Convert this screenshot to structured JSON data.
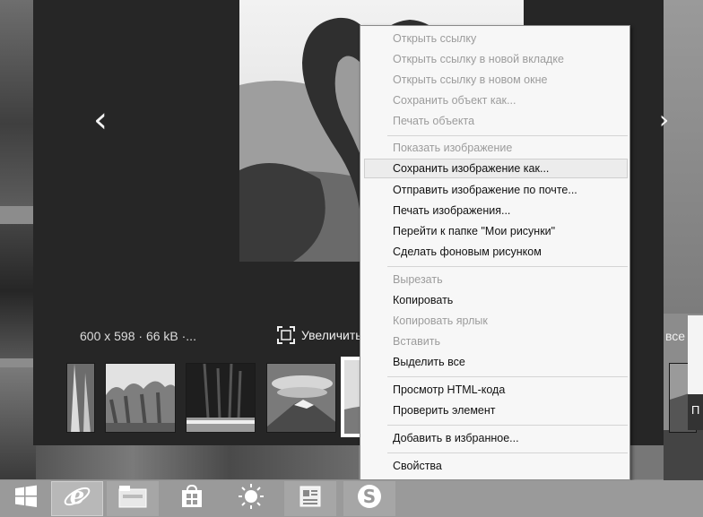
{
  "viewer": {
    "image_info": "600 x 598 · 66 kB ·...",
    "zoom_label": "Увеличить",
    "all_label": "все",
    "prev_glyph": "‹",
    "next_glyph": "›"
  },
  "thumbnails": [
    {
      "name": "thumb-waterfall"
    },
    {
      "name": "thumb-rock-formations"
    },
    {
      "name": "thumb-night-lights"
    },
    {
      "name": "thumb-mountain-clouds"
    },
    {
      "name": "thumb-heart-tree",
      "selected": true
    },
    {
      "name": "thumb-coast"
    }
  ],
  "context_menu": {
    "items": [
      {
        "label": "Открыть ссылку",
        "enabled": false
      },
      {
        "label": "Открыть ссылку в новой вкладке",
        "enabled": false
      },
      {
        "label": "Открыть ссылку в новом окне",
        "enabled": false
      },
      {
        "label": "Сохранить объект как...",
        "enabled": false
      },
      {
        "label": "Печать объекта",
        "enabled": false
      },
      {
        "label": "Показать изображение",
        "enabled": false
      },
      {
        "label": "Сохранить изображение как...",
        "enabled": true,
        "highlighted": true
      },
      {
        "label": "Отправить изображение по почте...",
        "enabled": true
      },
      {
        "label": "Печать изображения...",
        "enabled": true
      },
      {
        "label": "Перейти к папке \"Мои рисунки\"",
        "enabled": true
      },
      {
        "label": "Сделать фоновым рисунком",
        "enabled": true
      },
      {
        "label": "Вырезать",
        "enabled": false
      },
      {
        "label": "Копировать",
        "enabled": true
      },
      {
        "label": "Копировать ярлык",
        "enabled": false
      },
      {
        "label": "Вставить",
        "enabled": false
      },
      {
        "label": "Выделить все",
        "enabled": true
      },
      {
        "label": "Просмотр HTML-кода",
        "enabled": true
      },
      {
        "label": "Проверить элемент",
        "enabled": true
      },
      {
        "label": "Добавить в избранное...",
        "enabled": true
      },
      {
        "label": "Свойства",
        "enabled": true
      }
    ]
  },
  "edge_dialog": {
    "label": "П"
  },
  "taskbar": {
    "items": [
      {
        "name": "start-button",
        "icon": "windows-logo-icon"
      },
      {
        "name": "taskbar-ie",
        "icon": "internet-explorer-icon",
        "active": true
      },
      {
        "name": "taskbar-file-explorer",
        "icon": "folder-icon"
      },
      {
        "name": "taskbar-store",
        "icon": "store-bag-icon"
      },
      {
        "name": "taskbar-weather",
        "icon": "sun-icon"
      },
      {
        "name": "taskbar-reader",
        "icon": "document-reader-icon"
      },
      {
        "name": "taskbar-skype",
        "icon": "skype-icon"
      }
    ]
  }
}
